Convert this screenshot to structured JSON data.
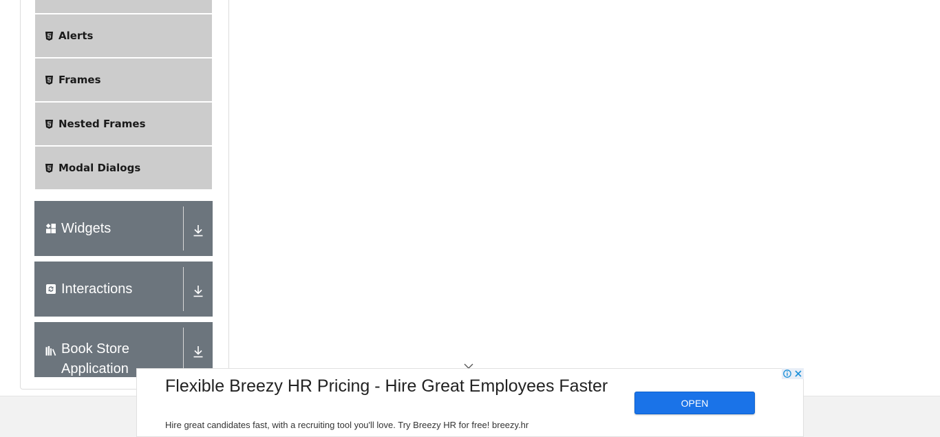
{
  "sidebar": {
    "sub_items": [
      {
        "label": "Alerts",
        "icon": "html5-icon"
      },
      {
        "label": "Frames",
        "icon": "html5-icon"
      },
      {
        "label": "Nested Frames",
        "icon": "html5-icon"
      },
      {
        "label": "Modal Dialogs",
        "icon": "html5-icon"
      }
    ],
    "groups": [
      {
        "label": "Widgets",
        "icon": "widgets-icon",
        "arrow": "download-arrow-icon"
      },
      {
        "label": "Interactions",
        "icon": "interactions-icon",
        "arrow": "download-arrow-icon"
      },
      {
        "label": "Book Store Application",
        "line1": "Book Store",
        "line2": "Application",
        "icon": "books-icon",
        "arrow": "download-arrow-icon"
      }
    ]
  },
  "ad": {
    "title": "Flexible Breezy HR Pricing - Hire Great Employees Faster",
    "description": "Hire great candidates fast, with a recruiting tool you'll love. Try Breezy HR for free! breezy.hr",
    "button_label": "OPEN",
    "info_icon": "info-icon",
    "close_icon": "close-icon",
    "accent_color": "#1a73e8"
  },
  "colors": {
    "sub_item_bg": "#cccccc",
    "group_bg": "#6c757d"
  }
}
